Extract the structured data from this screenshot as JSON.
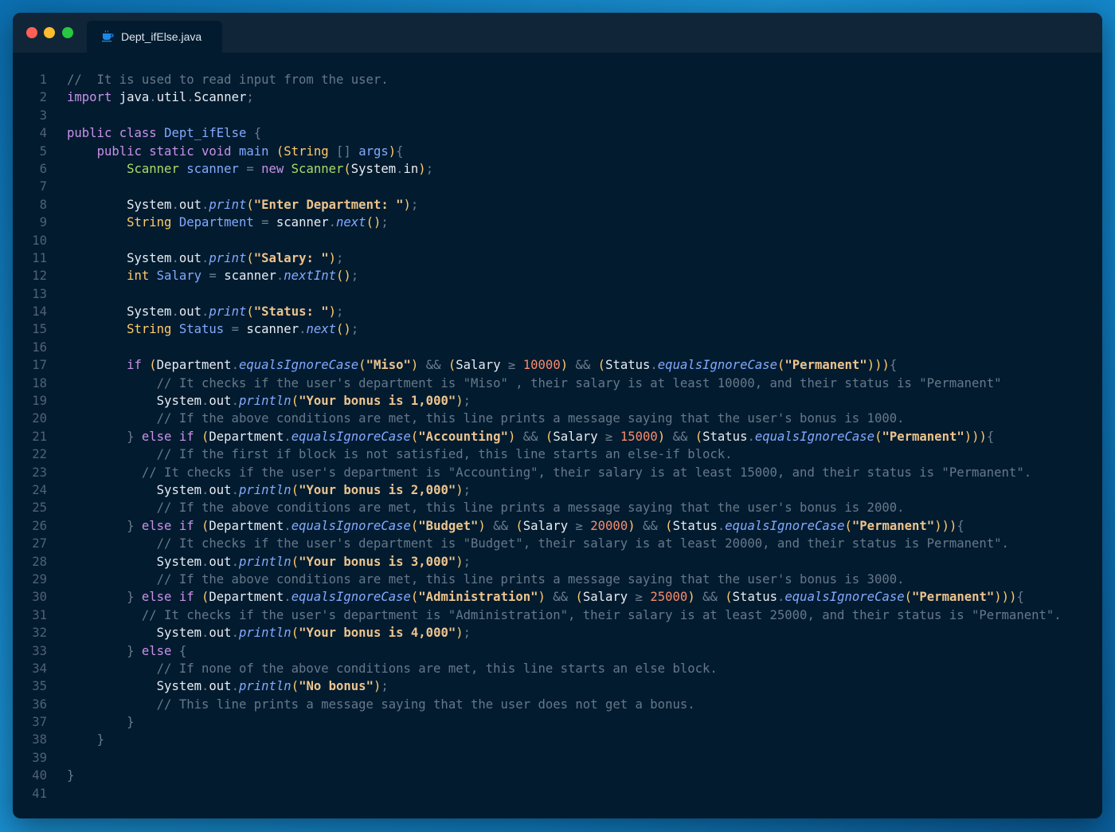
{
  "window": {
    "tab_label": "Dept_ifElse.java",
    "tab_icon": "java-coffee-icon"
  },
  "code_lines": [
    "1",
    "2",
    "3",
    "4",
    "5",
    "6",
    "7",
    "8",
    "9",
    "10",
    "11",
    "12",
    "13",
    "14",
    "15",
    "16",
    "17",
    "18",
    "19",
    "20",
    "21",
    "22",
    "23",
    "24",
    "25",
    "26",
    "27",
    "28",
    "29",
    "30",
    "31",
    "32",
    "33",
    "34",
    "35",
    "36",
    "37",
    "38",
    "39",
    "40",
    "41"
  ],
  "code": {
    "l1_comment": "//  It is used to read input from the user.",
    "l2_import": "import",
    "l2_pkg": "java",
    "l2_util": "util",
    "l2_scanner": "Scanner",
    "l4_public": "public",
    "l4_class": "class",
    "l4_name": "Dept_ifElse",
    "l5_mods": "public static void",
    "l5_main": "main",
    "l5_string": "String",
    "l5_args": "args",
    "l6_scanner_type": "Scanner",
    "l6_var": "scanner",
    "l6_new": "new",
    "l6_scanner_ctor": "Scanner",
    "l6_system": "System",
    "l6_in": "in",
    "print": "print",
    "println": "println",
    "system": "System",
    "out": "out",
    "l8_str": "\"Enter Department: \"",
    "l9_string": "String",
    "l9_var": "Department",
    "l9_scanner": "scanner",
    "l9_next": "next",
    "l11_str": "\"Salary: \"",
    "l12_int": "int",
    "l12_var": "Salary",
    "l12_scanner": "scanner",
    "l12_nextint": "nextInt",
    "l14_str": "\"Status: \"",
    "l15_string": "String",
    "l15_var": "Status",
    "l15_scanner": "scanner",
    "l15_next": "next",
    "if": "if",
    "else": "else",
    "department": "Department",
    "salary": "Salary",
    "status": "Status",
    "eic": "equalsIgnoreCase",
    "permanent": "\"Permanent\"",
    "l17_dept": "\"Miso\"",
    "l17_num": "10000",
    "l18_comment": "// It checks if the user's department is \"Miso\" , their salary is at least 10000, and their status is \"Permanent\"",
    "l19_str": "\"Your bonus is 1,000\"",
    "l20_comment": "// If the above conditions are met, this line prints a message saying that the user's bonus is 1000.",
    "l21_dept": "\"Accounting\"",
    "l21_num": "15000",
    "l22_comment": "// If the first if block is not satisfied, this line starts an else-if block.",
    "l23_comment": "// It checks if the user's department is \"Accounting\", their salary is at least 15000, and their status is \"Permanent\".",
    "l24_str": "\"Your bonus is 2,000\"",
    "l25_comment": "// If the above conditions are met, this line prints a message saying that the user's bonus is 2000.",
    "l26_dept": "\"Budget\"",
    "l26_num": "20000",
    "l27_comment": "// It checks if the user's department is \"Budget\", their salary is at least 20000, and their status is Permanent\".",
    "l28_str": "\"Your bonus is 3,000\"",
    "l29_comment": "// If the above conditions are met, this line prints a message saying that the user's bonus is 3000.",
    "l30_dept": "\"Administration\"",
    "l30_num": "25000",
    "l31_comment": "// It checks if the user's department is \"Administration\", their salary is at least 25000, and their status is \"Permanent\".",
    "l32_str": "\"Your bonus is 4,000\"",
    "l34_comment": "// If none of the above conditions are met, this line starts an else block.",
    "l35_str": "\"No bonus\"",
    "l36_comment": "// This line prints a message saying that the user does not get a bonus."
  }
}
